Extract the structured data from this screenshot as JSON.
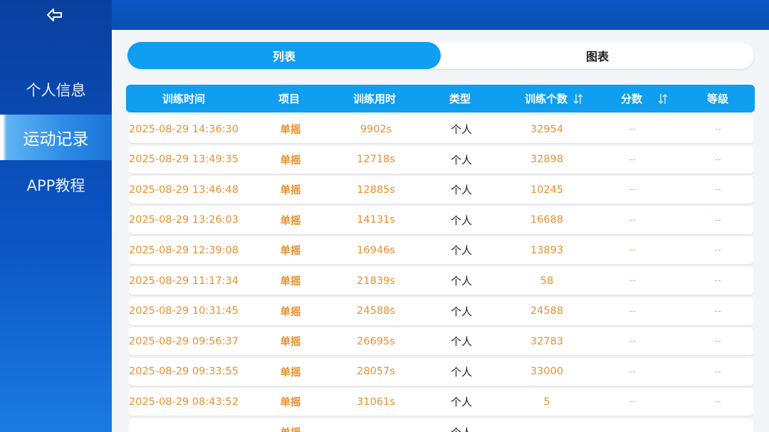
{
  "sidebar": {
    "back_icon": "arrow-left-icon",
    "items": [
      {
        "label": "个人信息",
        "active": false
      },
      {
        "label": "运动记录",
        "active": true
      },
      {
        "label": "APP教程",
        "active": false
      }
    ]
  },
  "tabs": [
    {
      "label": "列表",
      "active": true
    },
    {
      "label": "图表",
      "active": false
    }
  ],
  "table": {
    "headers": [
      {
        "label": "训练时间"
      },
      {
        "label": "项目"
      },
      {
        "label": "训练用时"
      },
      {
        "label": "类型"
      },
      {
        "label": "训练个数",
        "sort_icon": "sort-icon"
      },
      {
        "label": "分数",
        "sort_icon": "sort-icon"
      },
      {
        "label": "等级"
      }
    ],
    "rows": [
      {
        "time": "2025-08-29 14:36:30",
        "item": "单摇",
        "duration": "9902s",
        "type": "个人",
        "count": "32954",
        "score": "--",
        "level": "--"
      },
      {
        "time": "2025-08-29 13:49:35",
        "item": "单摇",
        "duration": "12718s",
        "type": "个人",
        "count": "32898",
        "score": "--",
        "level": "--"
      },
      {
        "time": "2025-08-29 13:46:48",
        "item": "单摇",
        "duration": "12885s",
        "type": "个人",
        "count": "10245",
        "score": "--",
        "level": "--"
      },
      {
        "time": "2025-08-29 13:26:03",
        "item": "单摇",
        "duration": "14131s",
        "type": "个人",
        "count": "16688",
        "score": "--",
        "level": "--"
      },
      {
        "time": "2025-08-29 12:39:08",
        "item": "单摇",
        "duration": "16946s",
        "type": "个人",
        "count": "13893",
        "score": "--",
        "level": "--"
      },
      {
        "time": "2025-08-29 11:17:34",
        "item": "单摇",
        "duration": "21839s",
        "type": "个人",
        "count": "58",
        "score": "--",
        "level": "--"
      },
      {
        "time": "2025-08-29 10:31:45",
        "item": "单摇",
        "duration": "24588s",
        "type": "个人",
        "count": "24588",
        "score": "--",
        "level": "--"
      },
      {
        "time": "2025-08-29 09:56:37",
        "item": "单摇",
        "duration": "26695s",
        "type": "个人",
        "count": "32783",
        "score": "--",
        "level": "--"
      },
      {
        "time": "2025-08-29 09:33:55",
        "item": "单摇",
        "duration": "28057s",
        "type": "个人",
        "count": "33000",
        "score": "--",
        "level": "--"
      },
      {
        "time": "2025-08-29 08:43:52",
        "item": "单摇",
        "duration": "31061s",
        "type": "个人",
        "count": "5",
        "score": "--",
        "level": "--"
      },
      {
        "time": "",
        "item": "单摇",
        "duration": "",
        "type": "个人",
        "count": "",
        "score": "",
        "level": ""
      }
    ]
  },
  "colors": {
    "sidebar_top": "#0a3f9e",
    "accent": "#0f9ef0",
    "row_text": "#e8902e"
  }
}
